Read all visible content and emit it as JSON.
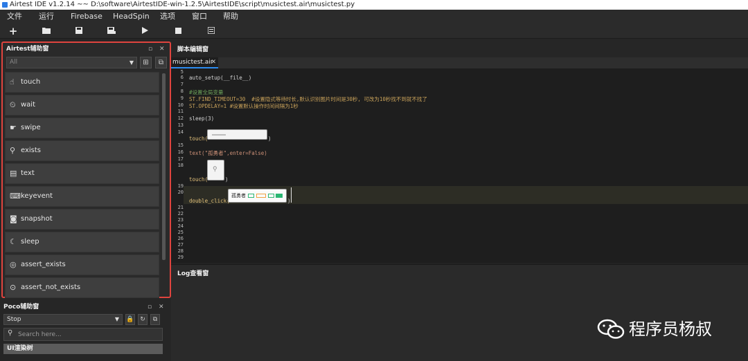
{
  "window": {
    "title": "Airtest IDE v1.2.14 ~~ D:\\software\\AirtestIDE-win-1.2.5\\AirtestIDE\\script\\musictest.air\\musictest.py"
  },
  "menu": [
    "文件",
    "运行",
    "Firebase",
    "HeadSpin",
    "选项",
    "窗口",
    "帮助"
  ],
  "toolbar": {
    "icons": [
      "new-icon",
      "open-icon",
      "save-icon",
      "save-as-icon",
      "run-icon",
      "stop-icon",
      "log-icon"
    ]
  },
  "airtest_panel": {
    "title": "Airtest辅助窗",
    "filter_value": "All",
    "commands": [
      {
        "label": "touch",
        "icon": "hand-icon"
      },
      {
        "label": "wait",
        "icon": "clock-icon"
      },
      {
        "label": "swipe",
        "icon": "swipe-icon"
      },
      {
        "label": "exists",
        "icon": "magnify-icon"
      },
      {
        "label": "text",
        "icon": "text-icon"
      },
      {
        "label": "keyevent",
        "icon": "keyboard-icon"
      },
      {
        "label": "snapshot",
        "icon": "camera-icon"
      },
      {
        "label": "sleep",
        "icon": "moon-icon"
      },
      {
        "label": "assert_exists",
        "icon": "target-icon"
      },
      {
        "label": "assert_not_exists",
        "icon": "target-off-icon"
      }
    ]
  },
  "poco_panel": {
    "title": "Poco辅助窗",
    "mode": "Stop",
    "search_placeholder": "Search here...",
    "ui_render": "UI渲染树"
  },
  "editor": {
    "title": "脚本编辑窗",
    "tab": "musictest.air",
    "lines": [
      {
        "n": "5",
        "t": ""
      },
      {
        "n": "6",
        "t": "auto_setup(__file__)"
      },
      {
        "n": "7",
        "t": ""
      },
      {
        "n": "8",
        "t": "#设置全局变量"
      },
      {
        "n": "9",
        "t": "ST.FIND_TIMEOUT=30  #设置隐式等待时长,默认识别图片时间是30秒, 可改为10秒找不到就不找了"
      },
      {
        "n": "10",
        "t": "ST.OPDELAY=1 #设置默认操作时间间隔为1秒"
      },
      {
        "n": "11",
        "t": ""
      },
      {
        "n": "12",
        "t": "sleep(3)"
      },
      {
        "n": "13",
        "t": ""
      },
      {
        "n": "14",
        "t": ""
      },
      {
        "n": "15",
        "t": ""
      },
      {
        "n": "16",
        "t": "text(\"孤勇者\",enter=False)"
      },
      {
        "n": "17",
        "t": ""
      },
      {
        "n": "18",
        "t": ""
      },
      {
        "n": "19",
        "t": ""
      },
      {
        "n": "20",
        "t": ""
      },
      {
        "n": "21",
        "t": ""
      },
      {
        "n": "22",
        "t": ""
      },
      {
        "n": "23",
        "t": ""
      },
      {
        "n": "24",
        "t": ""
      },
      {
        "n": "25",
        "t": ""
      },
      {
        "n": "26",
        "t": ""
      },
      {
        "n": "27",
        "t": ""
      },
      {
        "n": "28",
        "t": ""
      },
      {
        "n": "29",
        "t": ""
      }
    ],
    "touch1_prefix": "touch(",
    "touch2_prefix": "touch(",
    "dblclick_prefix": "double_click(",
    "paren_close": ")",
    "chip3_text": "孤勇者"
  },
  "log": {
    "title": "Log查看窗"
  },
  "watermark": {
    "text": "程序员杨叔"
  }
}
